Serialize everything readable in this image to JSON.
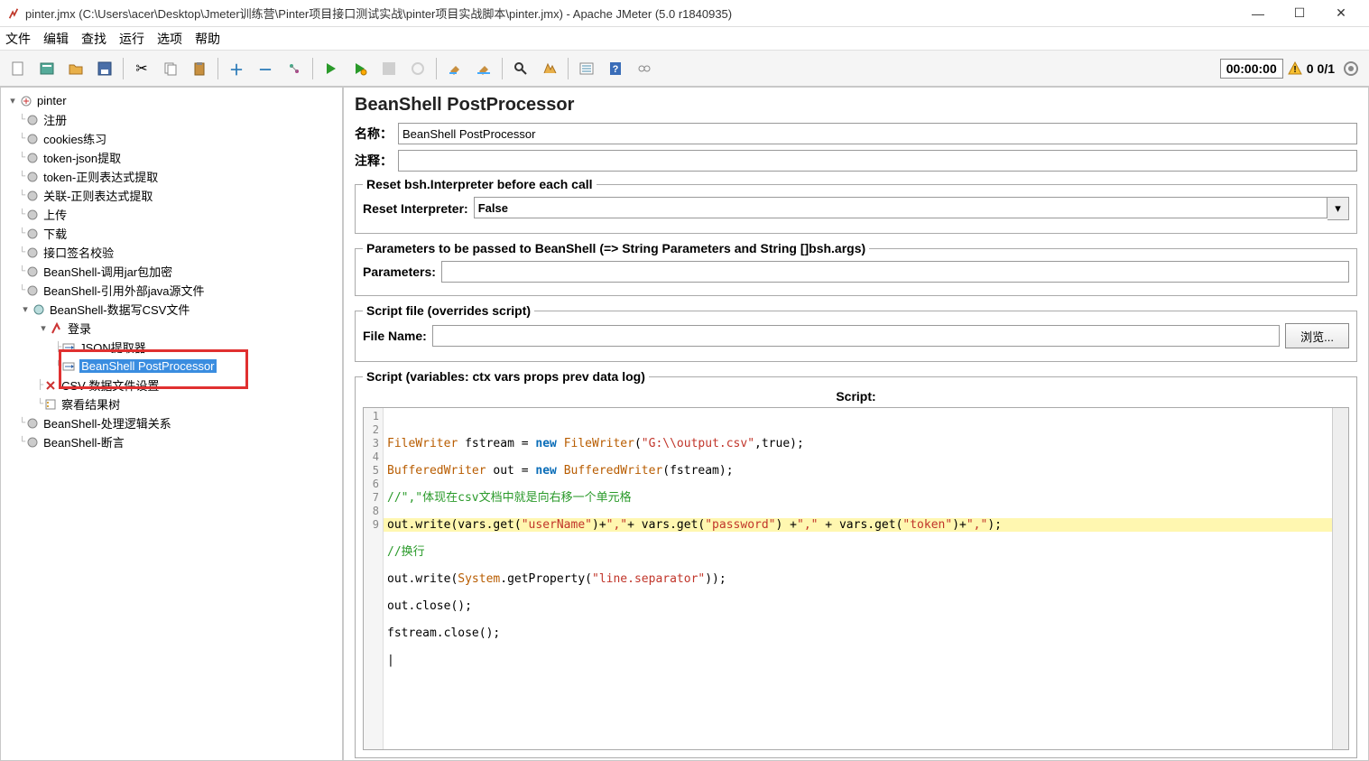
{
  "window": {
    "title": "pinter.jmx (C:\\Users\\acer\\Desktop\\Jmeter训练营\\Pinter项目接口测试实战\\pinter项目实战脚本\\pinter.jmx) - Apache JMeter (5.0 r1840935)"
  },
  "menubar": [
    "文件",
    "编辑",
    "查找",
    "运行",
    "选项",
    "帮助"
  ],
  "toolbar": {
    "timer": "00:00:00",
    "warn_count": "0",
    "thread_count": "0/1"
  },
  "tree": {
    "root": "pinter",
    "nodes": [
      "注册",
      "cookies练习",
      "token-json提取",
      "token-正则表达式提取",
      "关联-正则表达式提取",
      "上传",
      "下载",
      "接口签名校验",
      "BeanShell-调用jar包加密",
      "BeanShell-引用外部java源文件",
      "BeanShell-数据写CSV文件",
      "BeanShell-处理逻辑关系",
      "BeanShell-断言"
    ],
    "sub": {
      "login": "登录",
      "json_ext": "JSON提取器",
      "bsh_pp": "BeanShell PostProcessor",
      "csv_cfg": "CSV 数据文件设置",
      "view_tree": "察看结果树"
    }
  },
  "editor": {
    "title": "BeanShell PostProcessor",
    "name_label": "名称：",
    "name_value": "BeanShell PostProcessor",
    "comment_label": "注释：",
    "comment_value": "",
    "reset_legend": "Reset bsh.Interpreter before each call",
    "reset_label": "Reset Interpreter:",
    "reset_value": "False",
    "params_legend": "Parameters to be passed to BeanShell (=> String Parameters and String []bsh.args)",
    "params_label": "Parameters:",
    "params_value": "",
    "scriptfile_legend": "Script file (overrides script)",
    "filename_label": "File Name:",
    "filename_value": "",
    "browse_label": "浏览...",
    "script_legend": "Script (variables: ctx vars props prev data log)",
    "script_header": "Script:",
    "code": {
      "l1a": "FileWriter",
      "l1b": " fstream = ",
      "l1c": "new",
      "l1d": " ",
      "l1e": "FileWriter",
      "l1f": "(",
      "l1g": "\"G:\\\\output.csv\"",
      "l1h": ",true);",
      "l2a": "BufferedWriter",
      "l2b": " out = ",
      "l2c": "new",
      "l2d": " ",
      "l2e": "BufferedWriter",
      "l2f": "(fstream);",
      "l3": "//\",\"体现在csv文档中就是向右移一个单元格",
      "l4a": "out.write(vars.get(",
      "l4b": "\"userName\"",
      "l4c": ")+",
      "l4d": "\",\"",
      "l4e": "+ vars.get(",
      "l4f": "\"password\"",
      "l4g": ") +",
      "l4h": "\",\"",
      "l4i": " + vars.get(",
      "l4j": "\"token\"",
      "l4k": ")+",
      "l4l": "\",\"",
      "l4m": ");",
      "l5": "//换行",
      "l6a": "out.write(",
      "l6b": "System",
      "l6c": ".getProperty(",
      "l6d": "\"line.separator\"",
      "l6e": "));",
      "l7": "out.close();",
      "l8": "fstream.close();"
    }
  }
}
